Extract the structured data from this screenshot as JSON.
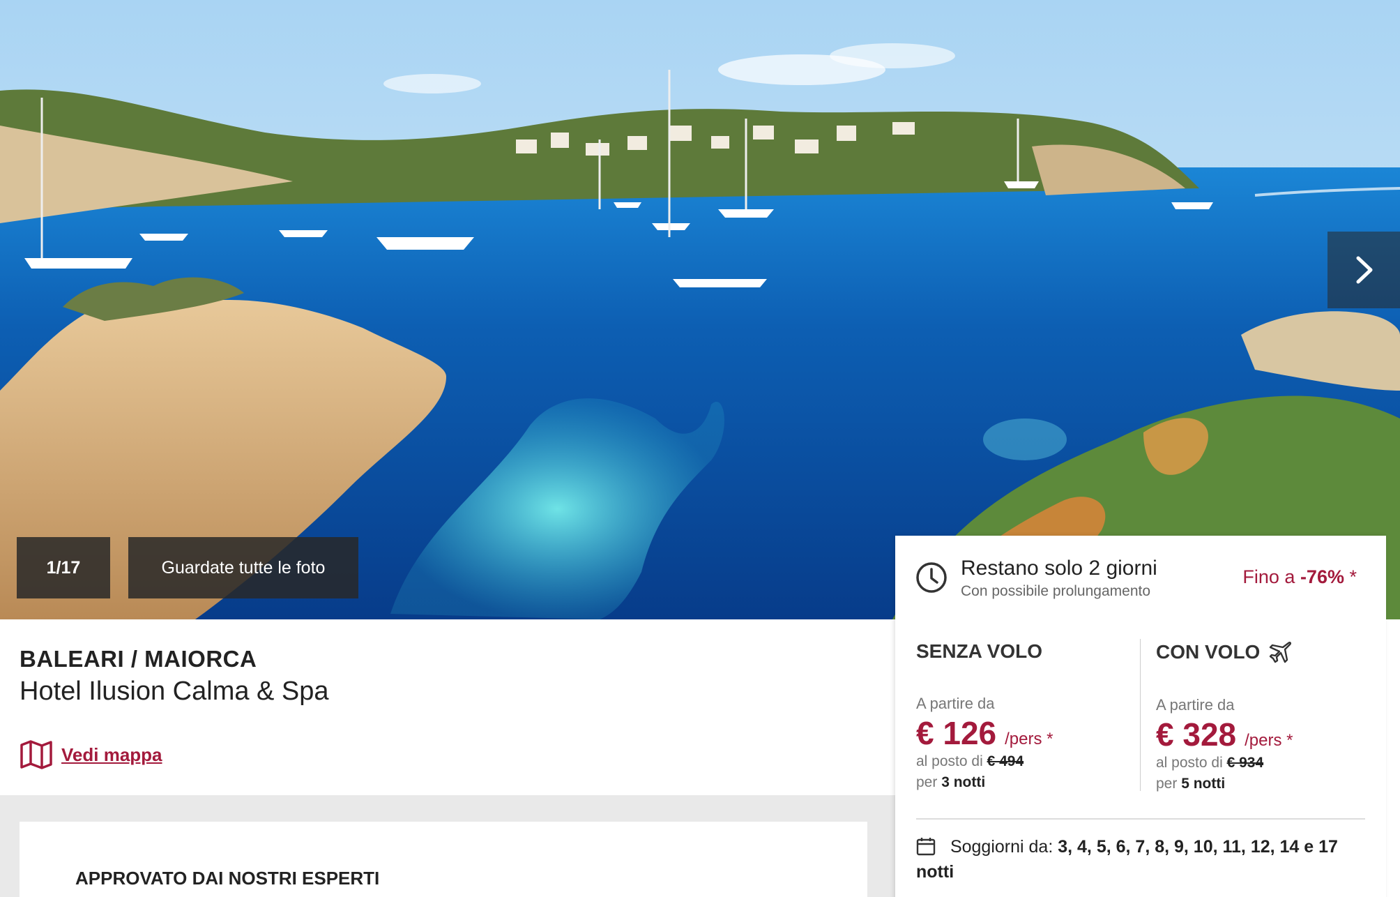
{
  "gallery": {
    "counter": "1/17",
    "view_all_label": "Guardate tutte le foto"
  },
  "hotel": {
    "location": "BALEARI / MAIORCA",
    "name": "Hotel Ilusion Calma & Spa",
    "map_link": "Vedi mappa"
  },
  "offer": {
    "days_left": "Restano solo 2 giorni",
    "extension": "Con possibile prolungamento",
    "discount_prefix": "Fino a",
    "discount_value": "-76%",
    "discount_suffix": "*"
  },
  "without_flight": {
    "title": "SENZA VOLO",
    "from_label": "A partire da",
    "price": "€ 126",
    "per": "/pers *",
    "instead_label": "al posto di",
    "old_price": "€ 494",
    "nights_prefix": "per",
    "nights": "3 notti"
  },
  "with_flight": {
    "title": "CON VOLO",
    "from_label": "A partire da",
    "price": "€ 328",
    "per": "/pers *",
    "instead_label": "al posto di",
    "old_price": "€ 934",
    "nights_prefix": "per",
    "nights": "5 notti"
  },
  "stays": {
    "label": "Soggiorni da:",
    "values": "3, 4, 5, 6, 7, 8, 9, 10, 11, 12, 14 e 17",
    "suffix": "notti"
  },
  "experts": {
    "title": "APPROVATO DAI NOSTRI ESPERTI"
  },
  "colors": {
    "brand": "#a31a3c",
    "sea": "#0d5fb3",
    "sky": "#bfe0f6"
  },
  "icons": [
    "chevron-right-icon",
    "clock-icon",
    "map-icon",
    "plane-icon",
    "calendar-icon"
  ]
}
